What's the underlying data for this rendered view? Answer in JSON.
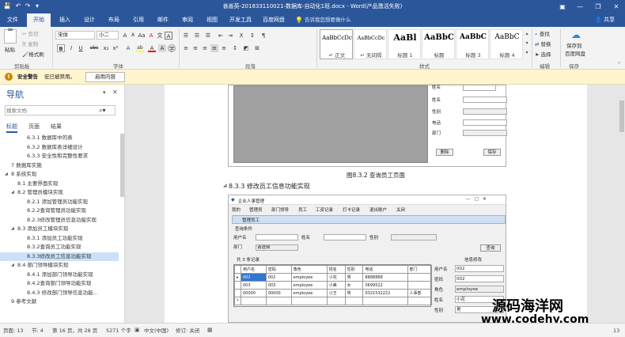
{
  "window": {
    "title": "善善英-201833110021-数据库-自动化1班.docx - Word(产品激活失败)",
    "minimize": "—",
    "restore": "❐",
    "close": "✕",
    "ribbon_options": "▣"
  },
  "quick_access": {
    "save": "💾",
    "undo": "↶",
    "redo": "↷",
    "more": "▾"
  },
  "tabs": [
    "文件",
    "开始",
    "插入",
    "设计",
    "布局",
    "引用",
    "邮件",
    "审阅",
    "视图",
    "开发工具",
    "百度网盘"
  ],
  "tellme": "告诉我您想要做什么",
  "share": "共享",
  "clipboard": {
    "paste": "粘贴",
    "cut": "剪切",
    "copy": "复制",
    "painter": "格式刷",
    "group": "剪贴板"
  },
  "font": {
    "name": "宋体",
    "size": "小二",
    "group": "字体",
    "bold": "B",
    "italic": "I",
    "underline": "U",
    "strike": "abc",
    "sub": "x₂",
    "sup": "x²",
    "grow": "A",
    "shrink": "A",
    "case": "Aa",
    "clear": "A",
    "highlight": "ab",
    "color": "A",
    "phonetic": "文",
    "border": "A"
  },
  "paragraph": {
    "group": "段落"
  },
  "styles": {
    "group": "样式",
    "items": [
      {
        "preview": "AaBbCcDc",
        "label": "↵ 正文"
      },
      {
        "preview": "AaBbCcDc",
        "label": "↵ 无间隔"
      },
      {
        "preview": "AaBl",
        "label": "标题 1"
      },
      {
        "preview": "AaBbC",
        "label": "标题"
      },
      {
        "preview": "AaBbC",
        "label": "标题 3"
      },
      {
        "preview": "AaBbC",
        "label": "标题 4"
      }
    ]
  },
  "editing": {
    "find": "查找",
    "replace": "替换",
    "select": "选择",
    "group": "编辑"
  },
  "save_group": {
    "label": "保存到",
    "label2": "百度网盘",
    "group": "保存"
  },
  "message_bar": {
    "title": "安全警告",
    "text": "宏已被禁用。",
    "button": "启用内容"
  },
  "navigation": {
    "title": "导航",
    "search_placeholder": "搜索文档",
    "tabs": [
      "标题",
      "页面",
      "结果"
    ],
    "items": [
      {
        "text": "6.3.1 数据库中的表",
        "level": 3,
        "arrow": ""
      },
      {
        "text": "6.3.2 数据库表详细设计",
        "level": 3,
        "arrow": ""
      },
      {
        "text": "6.3.3 安全性和完整性要求",
        "level": 3,
        "arrow": ""
      },
      {
        "text": "7 数据库实施",
        "level": 1,
        "arrow": ""
      },
      {
        "text": "8 系统实现",
        "level": 1,
        "arrow": "◢"
      },
      {
        "text": "8.1 主要界面实现",
        "level": 2,
        "arrow": ""
      },
      {
        "text": "8.2 管理员模块实现",
        "level": 2,
        "arrow": "◢"
      },
      {
        "text": "8.2.1 添加管理员功能实现",
        "level": 3,
        "arrow": ""
      },
      {
        "text": "8.2.2查询管理员功能实现",
        "level": 3,
        "arrow": ""
      },
      {
        "text": "8.2.3修改管理员信息功能实现",
        "level": 3,
        "arrow": ""
      },
      {
        "text": "8.3 添加员工模块实现",
        "level": 2,
        "arrow": "◢"
      },
      {
        "text": "8.3.1 添加员工功能实现",
        "level": 3,
        "arrow": ""
      },
      {
        "text": "8.3.2查询员工功能实现",
        "level": 3,
        "arrow": ""
      },
      {
        "text": "8.3.3修改员工信息功能实现",
        "level": 3,
        "arrow": "",
        "selected": true
      },
      {
        "text": "8.4 部门领导模块实现",
        "level": 2,
        "arrow": "◢"
      },
      {
        "text": "8.4.1 添加部门领导功能实现",
        "level": 3,
        "arrow": ""
      },
      {
        "text": "8.4.2查询部门领导功能实现",
        "level": 3,
        "arrow": ""
      },
      {
        "text": "8.4.3 修改部门领导信息功能...",
        "level": 3,
        "arrow": ""
      },
      {
        "text": "9 参考文献",
        "level": 1,
        "arrow": ""
      }
    ]
  },
  "document": {
    "fig1": {
      "labels": [
        "姓名",
        "性别",
        "电话",
        "部门"
      ],
      "top_label": "姓名",
      "delete": "删除",
      "save": "保存"
    },
    "caption": "图8.3.2 查询员工页面",
    "heading": "8.3.3 修改员工信息功能实现",
    "fig2": {
      "app_title": "企业人事管理",
      "menu": [
        "我的",
        "管理员",
        "部门领导",
        "员工",
        "工资记录",
        "打卡记录",
        "退出账户",
        "关闭"
      ],
      "inner_title": "管理员工",
      "query_group": "查询条件",
      "q_labels": [
        "用户名",
        "姓名",
        "性别",
        "部门"
      ],
      "dept_value": "请选择",
      "query_btn": "查询",
      "count": "共 3 条记录",
      "detail_group": "信息修改",
      "columns": [
        "用户名",
        "密码",
        "角色",
        "姓名",
        "性别",
        "电话",
        "部门"
      ],
      "rows": [
        [
          "002",
          "002",
          "employee",
          "小花",
          "男",
          "8888888",
          ""
        ],
        [
          "003",
          "003",
          "employee",
          "小美",
          "女",
          "0699522",
          ""
        ],
        [
          "00000",
          "00000",
          "employee",
          "小王",
          "男",
          "0321532222",
          "人事部"
        ]
      ],
      "detail_labels": [
        "用户名",
        "密码",
        "角色",
        "姓名",
        "性别"
      ],
      "detail_values": [
        "002",
        "002",
        "employee",
        "小花",
        "男"
      ]
    }
  },
  "status": {
    "page": "页面: 13",
    "section": "节: 4",
    "pages": "第 16 页，共 28 页",
    "words": "5271 个字",
    "lang": "中文(中国)",
    "track": "修订: 关闭",
    "zoom": "13"
  },
  "watermark": {
    "line1": "源码海洋网",
    "line2": "www.codehy.com"
  }
}
